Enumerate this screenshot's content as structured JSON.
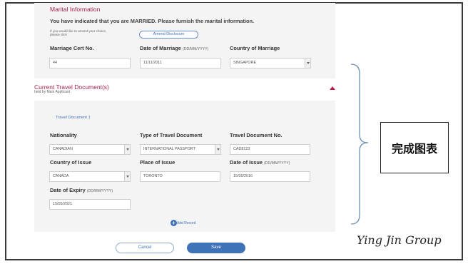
{
  "marital": {
    "title": "Marital Information",
    "notice": "You have indicated that you are MARRIED. Please furnish the marital information.",
    "amend_hint_line1": "If you would like to amend your choice,",
    "amend_hint_line2": "please click",
    "amend_button": "Amend Disclosure",
    "fields": {
      "cert_label": "Marriage Cert No.",
      "cert_value": "44",
      "date_label": "Date of Marriage",
      "date_hint": "(DD/MM/YYYY)",
      "date_value": "11/11/2011",
      "country_label": "Country of Marriage",
      "country_value": "SINGAPORE"
    }
  },
  "travel": {
    "title": "Current Travel Document(s)",
    "subtitle": "held by Main Applicant",
    "tab": "Travel Document 1",
    "nationality_label": "Nationality",
    "nationality_value": "CANADIAN",
    "type_label": "Type of Travel Document",
    "type_value": "INTERNATIONAL PASSPORT",
    "docno_label": "Travel Document No.",
    "docno_value": "CAD8123",
    "country_issue_label": "Country of Issue",
    "country_issue_value": "CANADA",
    "place_issue_label": "Place of Issue",
    "place_issue_value": "TORONTO",
    "date_issue_label": "Date of Issue",
    "date_issue_hint": "(DD/MM/YYYY)",
    "date_issue_value": "15/05/2016",
    "date_expiry_label": "Date of Expiry",
    "date_expiry_hint": "(DD/MM/YYYY)",
    "date_expiry_value": "15/05/2021",
    "add_record": "Add Record"
  },
  "actions": {
    "cancel": "Cancel",
    "save": "Save"
  },
  "annotation": {
    "callout_text": "完成图表",
    "watermark": "Ying Jin Group"
  },
  "colors": {
    "accent": "#a4204a",
    "link": "#3f6fb4",
    "save": "#3f73b8"
  }
}
